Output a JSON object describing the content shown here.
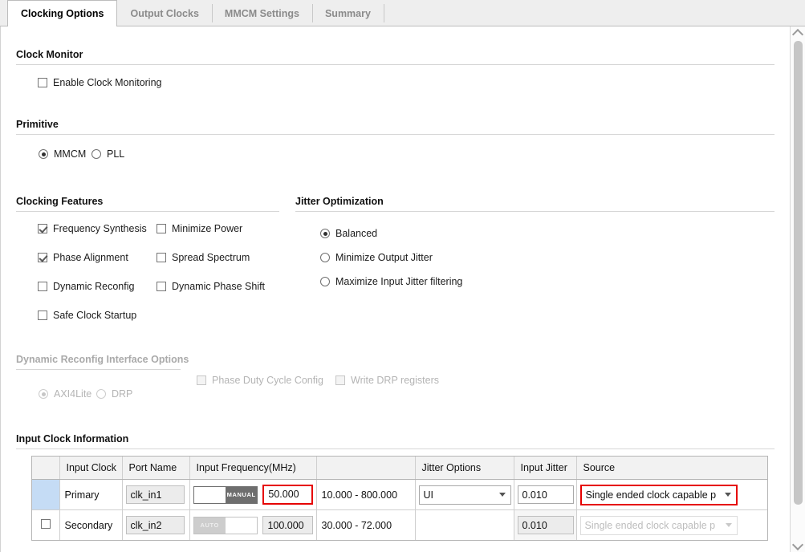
{
  "tabs": [
    {
      "label": "Clocking Options",
      "active": true
    },
    {
      "label": "Output Clocks",
      "active": false
    },
    {
      "label": "MMCM Settings",
      "active": false
    },
    {
      "label": "Summary",
      "active": false
    }
  ],
  "sections": {
    "clock_monitor": {
      "title": "Clock Monitor",
      "enable_clock_monitoring": {
        "label": "Enable Clock Monitoring",
        "checked": false
      }
    },
    "primitive": {
      "title": "Primitive",
      "options": [
        {
          "label": "MMCM",
          "selected": true
        },
        {
          "label": "PLL",
          "selected": false
        }
      ]
    },
    "clocking_features": {
      "title": "Clocking Features",
      "items": [
        {
          "label": "Frequency Synthesis",
          "checked": true
        },
        {
          "label": "Minimize Power",
          "checked": false
        },
        {
          "label": "Phase Alignment",
          "checked": true
        },
        {
          "label": "Spread Spectrum",
          "checked": false
        },
        {
          "label": "Dynamic Reconfig",
          "checked": false
        },
        {
          "label": "Dynamic Phase Shift",
          "checked": false
        },
        {
          "label": "Safe Clock Startup",
          "checked": false
        }
      ]
    },
    "jitter_optimization": {
      "title": "Jitter Optimization",
      "options": [
        {
          "label": "Balanced",
          "selected": true
        },
        {
          "label": "Minimize Output Jitter",
          "selected": false
        },
        {
          "label": "Maximize Input Jitter filtering",
          "selected": false
        }
      ]
    },
    "dynamic_reconfig": {
      "title": "Dynamic Reconfig Interface Options",
      "disabled": true,
      "radios": [
        {
          "label": "AXI4Lite",
          "selected": true
        },
        {
          "label": "DRP",
          "selected": false
        }
      ],
      "checkboxes": [
        {
          "label": "Phase Duty Cycle Config",
          "checked": false
        },
        {
          "label": "Write DRP registers",
          "checked": false
        }
      ]
    },
    "input_clock_information": {
      "title": "Input Clock Information",
      "columns": [
        "",
        "Input Clock",
        "Port Name",
        "Input Frequency(MHz)",
        "",
        "Jitter Options",
        "Input Jitter",
        "Source"
      ],
      "rows": [
        {
          "selected": true,
          "checkbox": null,
          "input_clock": "Primary",
          "port_name": "clk_in1",
          "toggle_mode": "MANUAL",
          "frequency": "50.000",
          "frequency_range": "10.000 - 800.000",
          "jitter_options": "UI",
          "input_jitter": "0.010",
          "source": "Single ended clock capable p",
          "highlight_frequency": true,
          "highlight_source": true,
          "disabled": false
        },
        {
          "selected": false,
          "checkbox": false,
          "input_clock": "Secondary",
          "port_name": "clk_in2",
          "toggle_mode": "AUTO",
          "frequency": "100.000",
          "frequency_range": "30.000 - 72.000",
          "jitter_options": "",
          "input_jitter": "0.010",
          "source": "Single ended clock capable p",
          "highlight_frequency": false,
          "highlight_source": false,
          "disabled": true
        }
      ]
    }
  },
  "colors": {
    "highlight": "#e60000",
    "selected_row": "#c5dcf5",
    "tab_inactive_text": "#8b8b8b"
  }
}
